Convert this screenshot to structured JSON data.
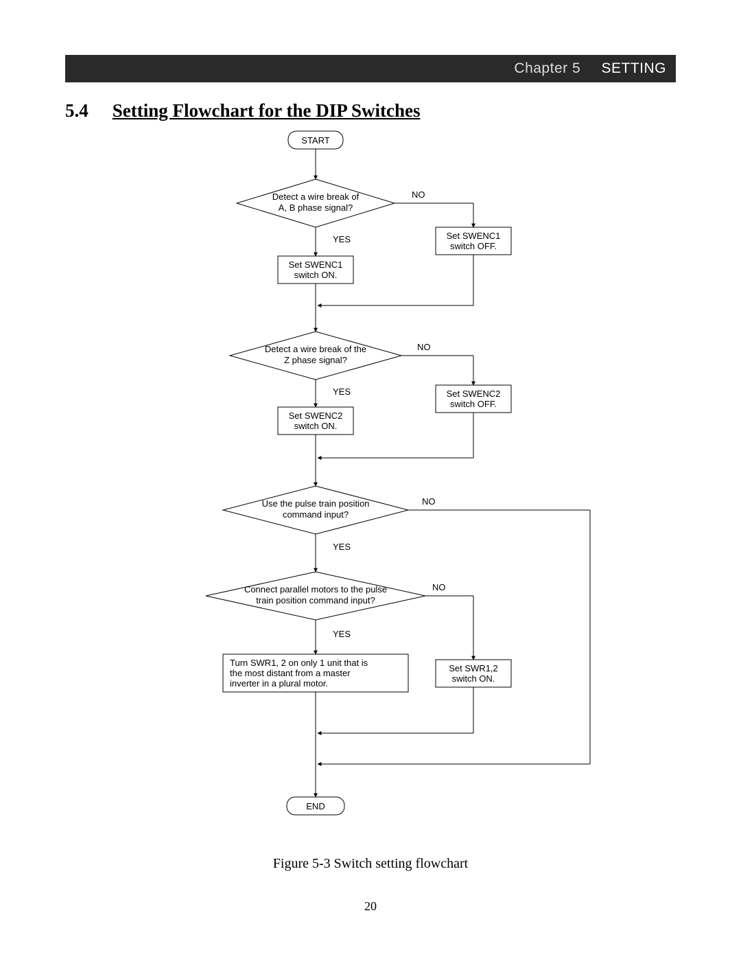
{
  "header": {
    "chapter": "Chapter 5",
    "title": "SETTING"
  },
  "section": {
    "number": "5.4",
    "title": "Setting Flowchart for the DIP Switches"
  },
  "flow": {
    "start": "START",
    "end": "END",
    "yes": "YES",
    "no": "NO",
    "d1": {
      "l1": "Detect a wire break of",
      "l2": "A, B phase signal?"
    },
    "p1yes": {
      "l1": "Set SWENC1",
      "l2": "switch ON."
    },
    "p1no": {
      "l1": "Set SWENC1",
      "l2": "switch OFF."
    },
    "d2": {
      "l1": "Detect a wire break of the",
      "l2": "Z phase signal?"
    },
    "p2yes": {
      "l1": "Set SWENC2",
      "l2": "switch ON."
    },
    "p2no": {
      "l1": "Set SWENC2",
      "l2": "switch OFF."
    },
    "d3": {
      "l1": "Use the pulse train position",
      "l2": "command input?"
    },
    "d4": {
      "l1": "Connect parallel motors to the pulse",
      "l2": "train position command input?"
    },
    "p4yes": {
      "l1": "Turn SWR1, 2 on only 1 unit that is",
      "l2": "the most distant from a master",
      "l3": "inverter in a plural motor."
    },
    "p4no": {
      "l1": "Set SWR1,2",
      "l2": "switch ON."
    }
  },
  "caption": "Figure 5-3  Switch setting flowchart",
  "page_number": "20"
}
